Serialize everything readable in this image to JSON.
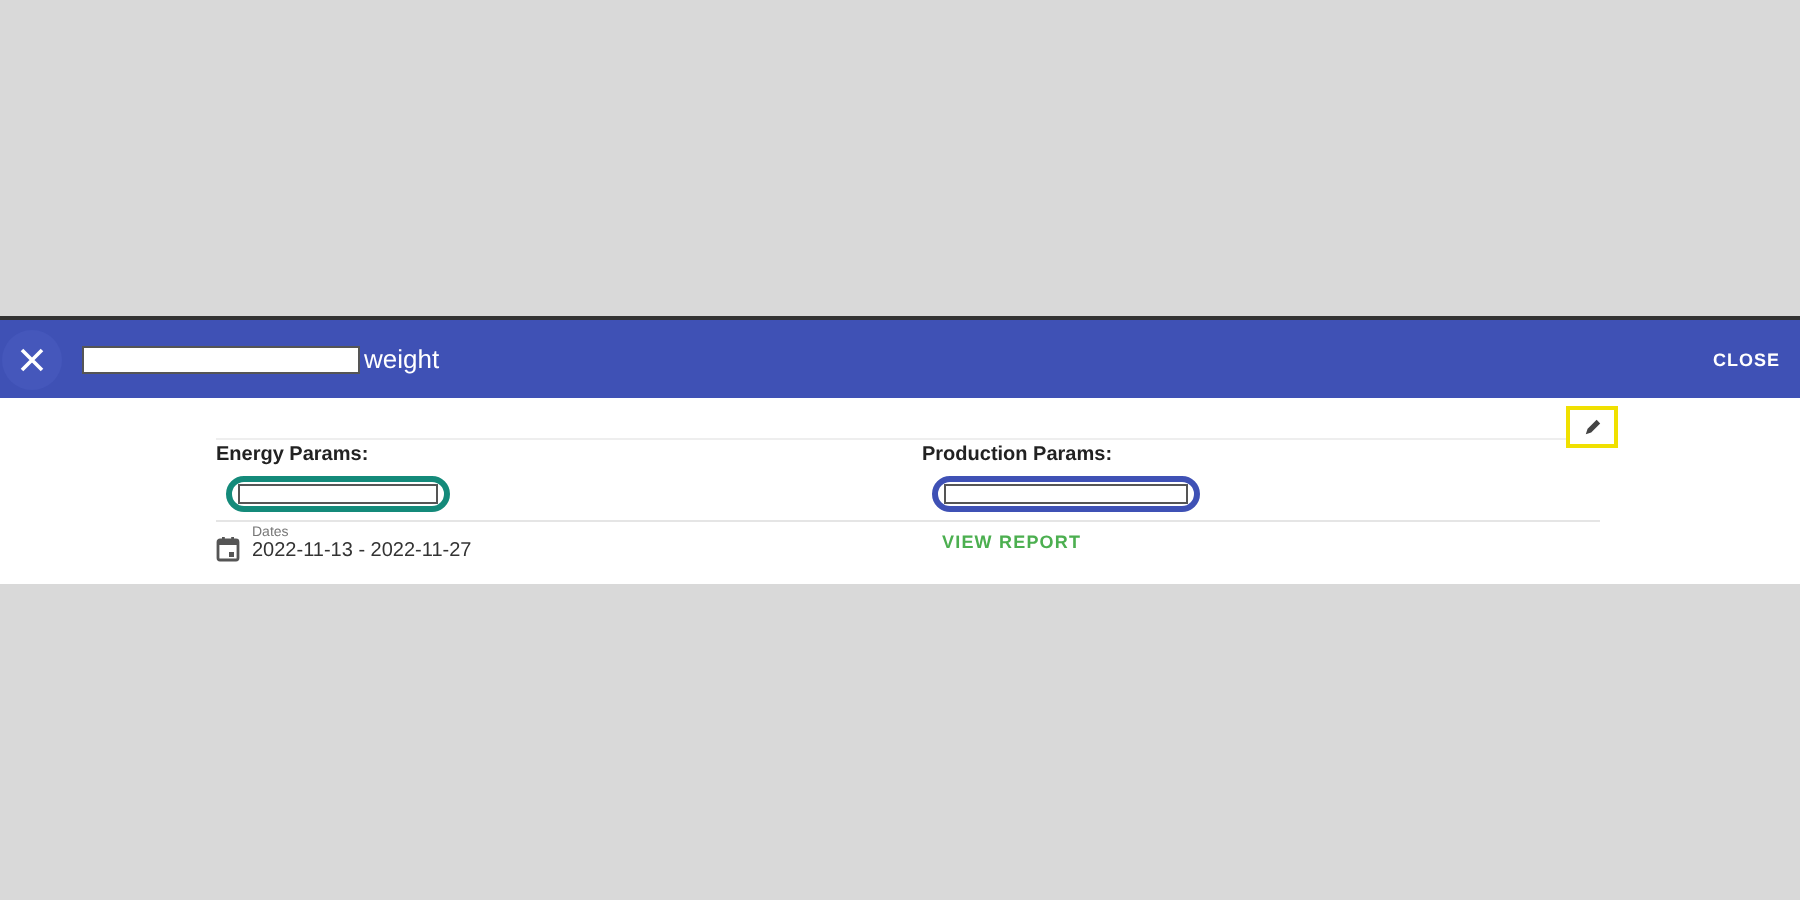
{
  "dialog": {
    "title": "weight",
    "close_button": "CLOSE"
  },
  "energy": {
    "label": "Energy Params:",
    "chip": {
      "color": "#148a7a"
    }
  },
  "production": {
    "label": "Production Params:",
    "chip": {
      "color": "#3f51b5"
    }
  },
  "dates": {
    "label": "Dates",
    "value": "2022-11-13 - 2022-11-27"
  },
  "view_report": "VIEW REPORT"
}
